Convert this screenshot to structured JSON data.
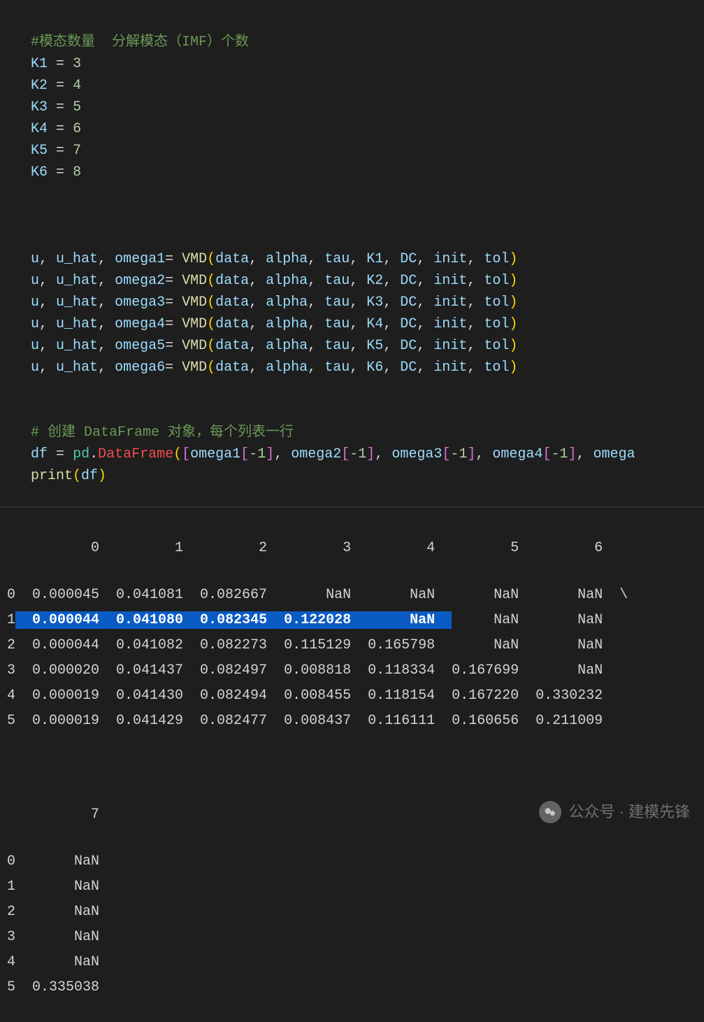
{
  "code": {
    "comment1": "#模态数量  分解模态（IMF）个数",
    "assigns": [
      {
        "name": "K1",
        "value": "3"
      },
      {
        "name": "K2",
        "value": "4"
      },
      {
        "name": "K3",
        "value": "5"
      },
      {
        "name": "K4",
        "value": "6"
      },
      {
        "name": "K5",
        "value": "7"
      },
      {
        "name": "K6",
        "value": "8"
      }
    ],
    "vmd_lines": [
      {
        "targets": "u, u_hat, omega1",
        "k": "K1"
      },
      {
        "targets": "u, u_hat, omega2",
        "k": "K2"
      },
      {
        "targets": "u, u_hat, omega3",
        "k": "K3"
      },
      {
        "targets": "u, u_hat, omega4",
        "k": "K4"
      },
      {
        "targets": "u, u_hat, omega5",
        "k": "K5"
      },
      {
        "targets": "u, u_hat, omega6",
        "k": "K6"
      }
    ],
    "vmd_fn": "VMD",
    "vmd_args_pre": "data, alpha, tau, ",
    "vmd_args_post": ", DC, init, tol",
    "comment2": "# 创建 DataFrame 对象，每个列表一行",
    "df_var": "df",
    "pd": "pd",
    "dataframe": "DataFrame",
    "df_args": "omega1[-1], omega2[-1], omega3[-1], omega4[-1], omega",
    "print": "print",
    "print_arg": "df"
  },
  "output": {
    "header1": "          0         1         2         3         4         5         6   ",
    "rows1": [
      {
        "idx": "0",
        "cells": "  0.000045  0.041081  0.082667       NaN       NaN       NaN       NaN  \\",
        "hl": false
      },
      {
        "idx": "1",
        "cells": "  0.000044  0.041080  0.082345  0.122028       NaN       NaN       NaN   ",
        "hl": true,
        "hl_end": 52
      },
      {
        "idx": "2",
        "cells": "  0.000044  0.041082  0.082273  0.115129  0.165798       NaN       NaN   ",
        "hl": false
      },
      {
        "idx": "3",
        "cells": "  0.000020  0.041437  0.082497  0.008818  0.118334  0.167699       NaN   ",
        "hl": false
      },
      {
        "idx": "4",
        "cells": "  0.000019  0.041430  0.082494  0.008455  0.118154  0.167220  0.330232   ",
        "hl": false
      },
      {
        "idx": "5",
        "cells": "  0.000019  0.041429  0.082477  0.008437  0.116111  0.160656  0.211009   ",
        "hl": false
      }
    ],
    "header2": "          7  ",
    "rows2": [
      {
        "idx": "0",
        "cells": "       NaN  "
      },
      {
        "idx": "1",
        "cells": "       NaN  "
      },
      {
        "idx": "2",
        "cells": "       NaN  "
      },
      {
        "idx": "3",
        "cells": "       NaN  "
      },
      {
        "idx": "4",
        "cells": "       NaN  "
      },
      {
        "idx": "5",
        "cells": "  0.335038  "
      }
    ]
  },
  "watermark": {
    "text": "公众号 · 建模先锋"
  }
}
